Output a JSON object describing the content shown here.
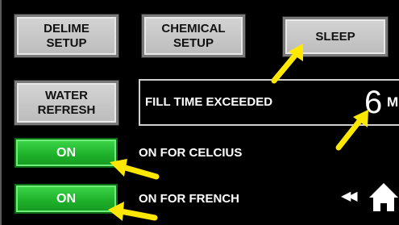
{
  "buttons": {
    "delime_setup": "DELIME\nSETUP",
    "chemical_setup": "CHEMICAL\nSETUP",
    "sleep": "SLEEP",
    "water_refresh": "WATER\nREFRESH"
  },
  "status": {
    "message": "FILL TIME EXCEEDED",
    "value": "6",
    "unit": "M"
  },
  "toggles": [
    {
      "state": "ON",
      "label": "ON FOR CELCIUS"
    },
    {
      "state": "ON",
      "label": "ON FOR FRENCH"
    }
  ],
  "icons": {
    "back": "rewind-icon",
    "home": "home-icon",
    "annotation": "yellow-arrow-icon"
  },
  "colors": {
    "background": "#000000",
    "button_gray": "#c8c8c8",
    "toggle_green": "#22b22e",
    "annotation_yellow": "#ffe800"
  }
}
